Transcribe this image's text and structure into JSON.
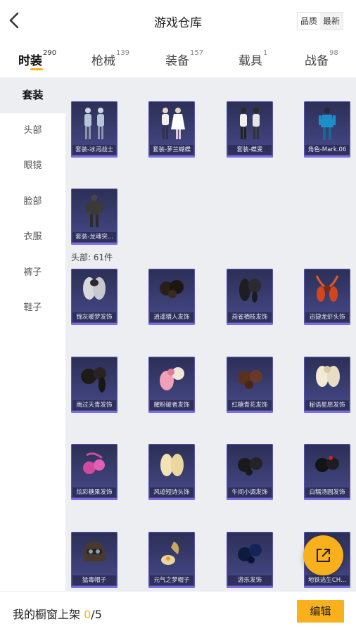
{
  "header": {
    "title": "游戏仓库",
    "sort_quality": "品质",
    "sort_newest": "最新"
  },
  "tabs": [
    {
      "label": "时装",
      "count": "290",
      "active": true
    },
    {
      "label": "枪械",
      "count": "139",
      "active": false
    },
    {
      "label": "装备",
      "count": "157",
      "active": false
    },
    {
      "label": "载具",
      "count": "1",
      "active": false
    },
    {
      "label": "战备",
      "count": "98",
      "active": false
    }
  ],
  "sidebar": {
    "items": [
      {
        "label": "套装",
        "active": true
      },
      {
        "label": "头部",
        "active": false
      },
      {
        "label": "眼镜",
        "active": false
      },
      {
        "label": "脸部",
        "active": false
      },
      {
        "label": "衣服",
        "active": false
      },
      {
        "label": "裤子",
        "active": false
      },
      {
        "label": "鞋子",
        "active": false
      }
    ]
  },
  "sets": {
    "items": [
      {
        "label": "套装-冰河战士",
        "icon": "outfit-figure-icon"
      },
      {
        "label": "套装-萝兰蝴蝶",
        "icon": "outfit-figure-icon"
      },
      {
        "label": "套装-蝶变",
        "icon": "outfit-figure-icon"
      },
      {
        "label": "角色-Mark.06",
        "icon": "character-figure-icon"
      },
      {
        "label": "套装-龙魂突...",
        "icon": "outfit-figure-icon"
      }
    ]
  },
  "head": {
    "section_label": "头部: 61件",
    "items": [
      {
        "label": "锦灰暖梦发饰",
        "icon": "hair-icon"
      },
      {
        "label": "逍遥猎人发饰",
        "icon": "hair-icon"
      },
      {
        "label": "燕雀栖枝发饰",
        "icon": "hair-icon"
      },
      {
        "label": "迅捷龙虾头饰",
        "icon": "lobster-headwear-icon"
      },
      {
        "label": "雨过天青发饰",
        "icon": "hair-icon"
      },
      {
        "label": "耀粉破者发饰",
        "icon": "hair-icon"
      },
      {
        "label": "红糖青花发饰",
        "icon": "hair-icon"
      },
      {
        "label": "秘语星愿发饰",
        "icon": "hair-icon"
      },
      {
        "label": "炫彩糖果发饰",
        "icon": "hair-icon"
      },
      {
        "label": "风迹短诗头饰",
        "icon": "hair-icon"
      },
      {
        "label": "午间小调发饰",
        "icon": "hair-icon"
      },
      {
        "label": "白糯汤圆发饰",
        "icon": "hair-icon"
      },
      {
        "label": "猛毒帽子",
        "icon": "helmet-icon"
      },
      {
        "label": "元气之梦帽子",
        "icon": "hat-icon"
      },
      {
        "label": "游乐发饰",
        "icon": "hair-icon"
      },
      {
        "label": "地铁逃生CH...",
        "icon": "hair-icon"
      }
    ]
  },
  "bottom": {
    "shelf_label": "我的橱窗上架",
    "shelf_current": "0",
    "shelf_sep": "/",
    "shelf_total": "5",
    "edit_label": "编辑"
  },
  "colors": {
    "accent": "#f8b01c",
    "card_bg": "#3a3e72",
    "card_border": "#5a54b6",
    "content_bg": "#eceef1"
  }
}
